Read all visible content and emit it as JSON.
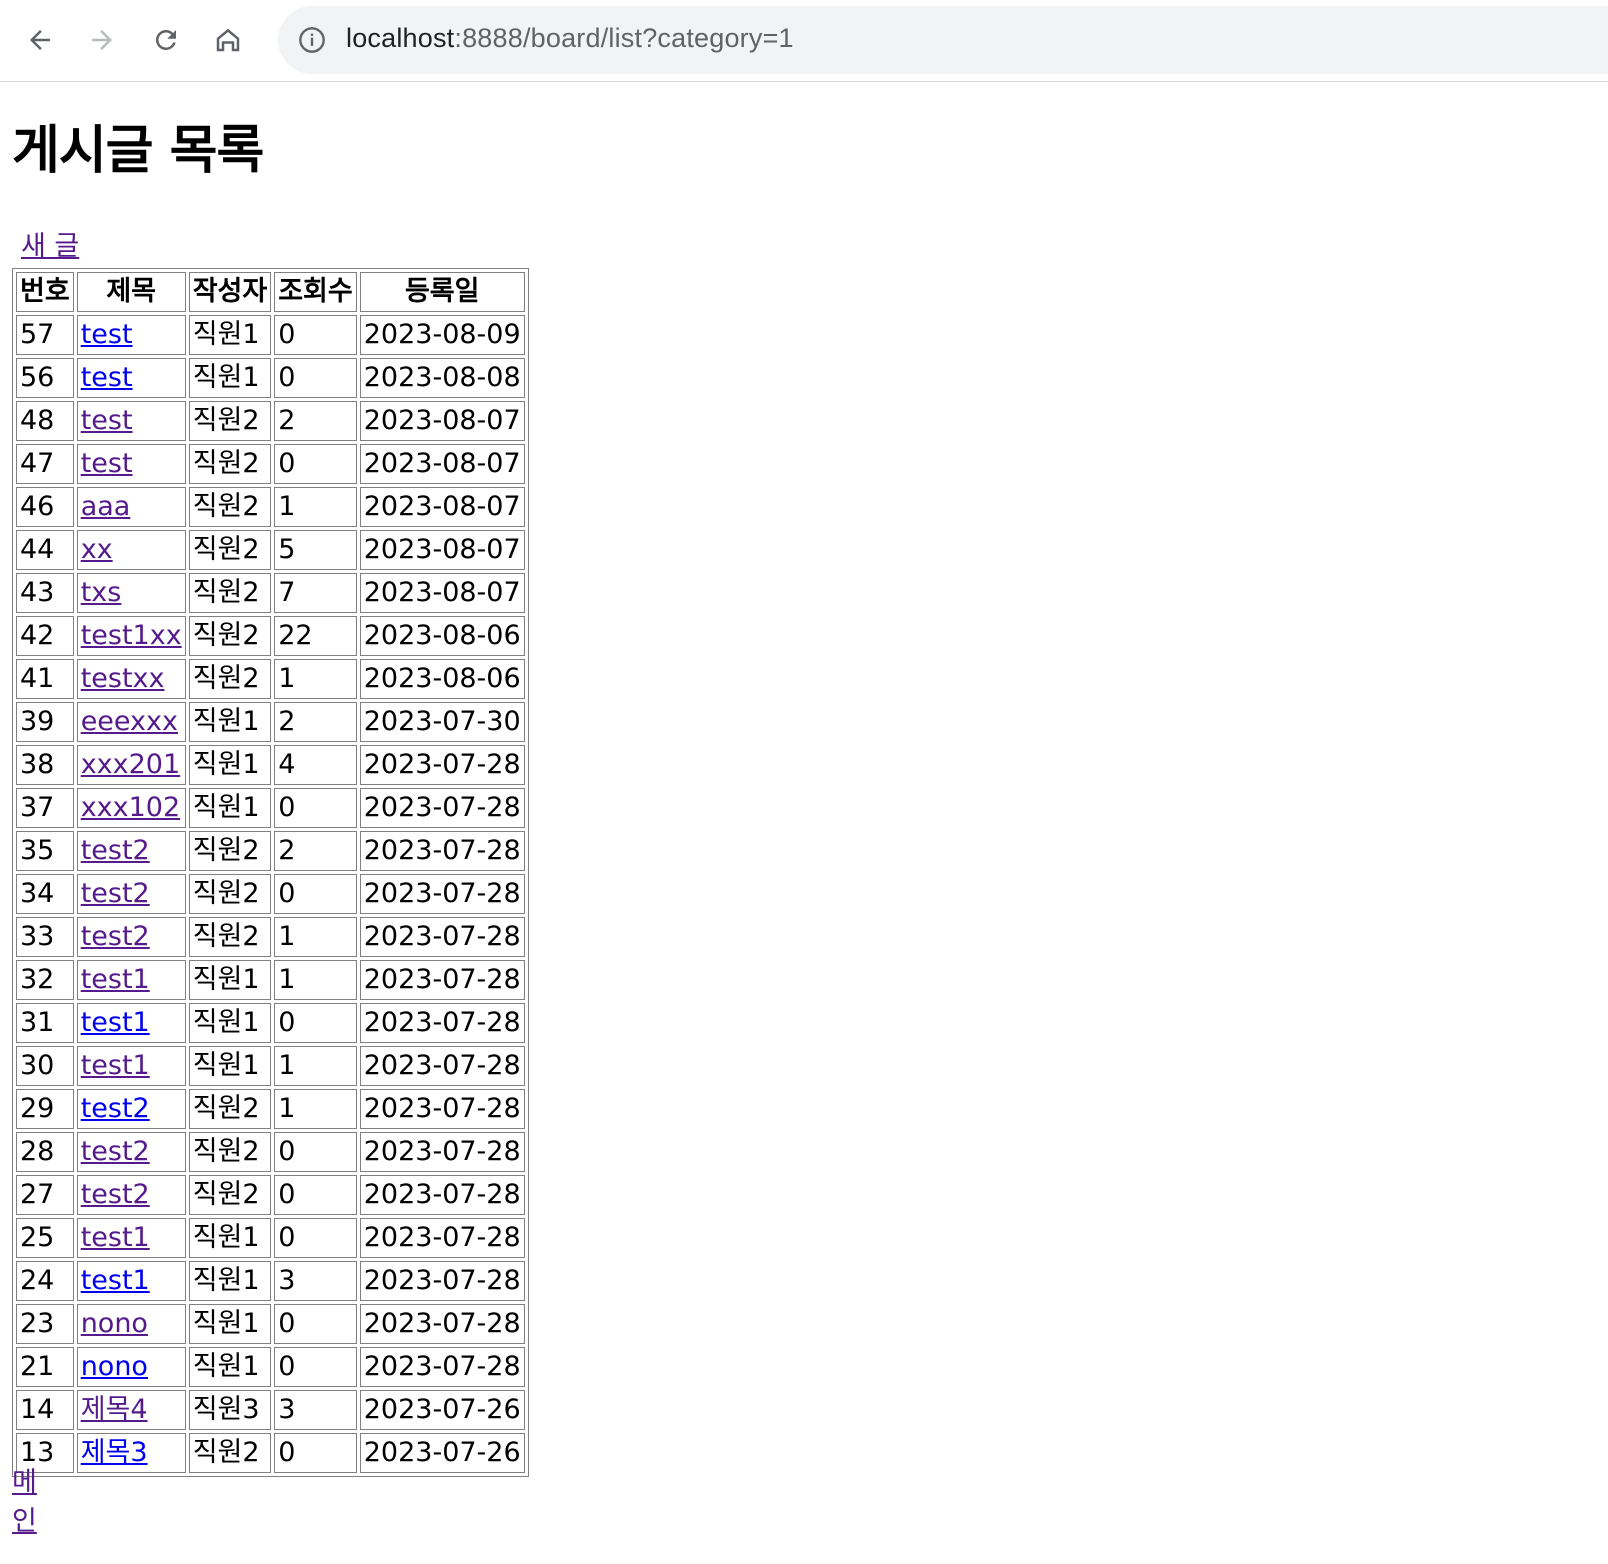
{
  "browser": {
    "url_host": "localhost",
    "url_path": ":8888/board/list?category=1"
  },
  "page": {
    "title": "게시글 목록",
    "new_post_link": "새 글",
    "main_link": "메인"
  },
  "table": {
    "headers": [
      "번호",
      "제목",
      "작성자",
      "조회수",
      "등록일"
    ],
    "rows": [
      {
        "no": "57",
        "title": "test",
        "author": "직원1",
        "views": "0",
        "date": "2023-08-09",
        "visited": false
      },
      {
        "no": "56",
        "title": "test",
        "author": "직원1",
        "views": "0",
        "date": "2023-08-08",
        "visited": false
      },
      {
        "no": "48",
        "title": "test",
        "author": "직원2",
        "views": "2",
        "date": "2023-08-07",
        "visited": true
      },
      {
        "no": "47",
        "title": "test",
        "author": "직원2",
        "views": "0",
        "date": "2023-08-07",
        "visited": true
      },
      {
        "no": "46",
        "title": "aaa",
        "author": "직원2",
        "views": "1",
        "date": "2023-08-07",
        "visited": true
      },
      {
        "no": "44",
        "title": "xx",
        "author": "직원2",
        "views": "5",
        "date": "2023-08-07",
        "visited": true
      },
      {
        "no": "43",
        "title": "txs",
        "author": "직원2",
        "views": "7",
        "date": "2023-08-07",
        "visited": true
      },
      {
        "no": "42",
        "title": "test1xx",
        "author": "직원2",
        "views": "22",
        "date": "2023-08-06",
        "visited": true
      },
      {
        "no": "41",
        "title": "testxx",
        "author": "직원2",
        "views": "1",
        "date": "2023-08-06",
        "visited": true
      },
      {
        "no": "39",
        "title": "eeexxx",
        "author": "직원1",
        "views": "2",
        "date": "2023-07-30",
        "visited": true
      },
      {
        "no": "38",
        "title": "xxx201",
        "author": "직원1",
        "views": "4",
        "date": "2023-07-28",
        "visited": true
      },
      {
        "no": "37",
        "title": "xxx102",
        "author": "직원1",
        "views": "0",
        "date": "2023-07-28",
        "visited": true
      },
      {
        "no": "35",
        "title": "test2",
        "author": "직원2",
        "views": "2",
        "date": "2023-07-28",
        "visited": true
      },
      {
        "no": "34",
        "title": "test2",
        "author": "직원2",
        "views": "0",
        "date": "2023-07-28",
        "visited": true
      },
      {
        "no": "33",
        "title": "test2",
        "author": "직원2",
        "views": "1",
        "date": "2023-07-28",
        "visited": true
      },
      {
        "no": "32",
        "title": "test1",
        "author": "직원1",
        "views": "1",
        "date": "2023-07-28",
        "visited": true
      },
      {
        "no": "31",
        "title": "test1",
        "author": "직원1",
        "views": "0",
        "date": "2023-07-28",
        "visited": false
      },
      {
        "no": "30",
        "title": "test1",
        "author": "직원1",
        "views": "1",
        "date": "2023-07-28",
        "visited": true
      },
      {
        "no": "29",
        "title": "test2",
        "author": "직원2",
        "views": "1",
        "date": "2023-07-28",
        "visited": false
      },
      {
        "no": "28",
        "title": "test2",
        "author": "직원2",
        "views": "0",
        "date": "2023-07-28",
        "visited": true
      },
      {
        "no": "27",
        "title": "test2",
        "author": "직원2",
        "views": "0",
        "date": "2023-07-28",
        "visited": true
      },
      {
        "no": "25",
        "title": "test1",
        "author": "직원1",
        "views": "0",
        "date": "2023-07-28",
        "visited": true
      },
      {
        "no": "24",
        "title": "test1",
        "author": "직원1",
        "views": "3",
        "date": "2023-07-28",
        "visited": false
      },
      {
        "no": "23",
        "title": "nono",
        "author": "직원1",
        "views": "0",
        "date": "2023-07-28",
        "visited": true
      },
      {
        "no": "21",
        "title": "nono",
        "author": "직원1",
        "views": "0",
        "date": "2023-07-28",
        "visited": false
      },
      {
        "no": "14",
        "title": "제목4",
        "author": "직원3",
        "views": "3",
        "date": "2023-07-26",
        "visited": true
      },
      {
        "no": "13",
        "title": "제목3",
        "author": "직원2",
        "views": "0",
        "date": "2023-07-26",
        "visited": false
      }
    ]
  },
  "colors": {
    "link_visited": "#551a8b",
    "link_unvisited": "#0000ee",
    "address_bar_bg": "#f1f3f4"
  }
}
